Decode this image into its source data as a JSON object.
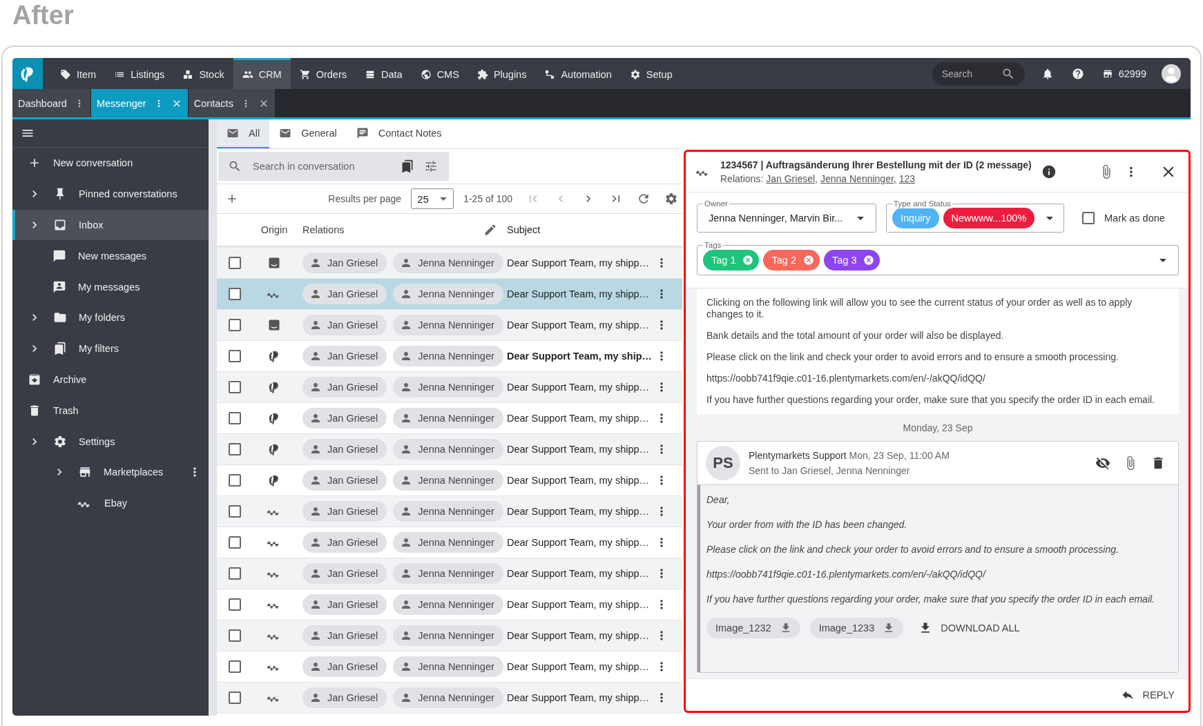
{
  "heading": "After",
  "nav": {
    "items": [
      {
        "label": "Item",
        "selected": false
      },
      {
        "label": "Listings",
        "selected": false
      },
      {
        "label": "Stock",
        "selected": false
      },
      {
        "label": "CRM",
        "selected": true
      },
      {
        "label": "Orders",
        "selected": false
      },
      {
        "label": "Data",
        "selected": false
      },
      {
        "label": "CMS",
        "selected": false
      },
      {
        "label": "Plugins",
        "selected": false
      },
      {
        "label": "Automation",
        "selected": false
      },
      {
        "label": "Setup",
        "selected": false
      }
    ],
    "search": {
      "placeholder": "Search"
    },
    "shop_id": "62999"
  },
  "tabs": [
    {
      "label": "Dashboard",
      "selected": false,
      "closable": false
    },
    {
      "label": "Messenger",
      "selected": true,
      "closable": true
    },
    {
      "label": "Contacts",
      "selected": false,
      "closable": true
    }
  ],
  "sidebar": {
    "items": [
      {
        "label": "New conversation",
        "expandable": false,
        "selected": false,
        "menu": false
      },
      {
        "label": "Pinned converstations",
        "expandable": true,
        "selected": false,
        "menu": false
      },
      {
        "label": "Inbox",
        "expandable": true,
        "selected": true,
        "menu": false,
        "children": [
          {
            "label": "New messages",
            "expandable": false,
            "selected": false,
            "menu": false
          },
          {
            "label": "My messages",
            "expandable": false,
            "selected": false,
            "menu": false
          }
        ]
      },
      {
        "label": "My folders",
        "expandable": true,
        "selected": false,
        "menu": false
      },
      {
        "label": "My filters",
        "expandable": true,
        "selected": false,
        "menu": false
      },
      {
        "label": "Archive",
        "expandable": false,
        "selected": false,
        "menu": false
      },
      {
        "label": "Trash",
        "expandable": false,
        "selected": false,
        "menu": false
      },
      {
        "label": "Settings",
        "expandable": true,
        "selected": false,
        "menu": false,
        "children": [
          {
            "label": "Marketplaces",
            "expandable": true,
            "selected": false,
            "menu": true,
            "children": [
              {
                "label": "Ebay",
                "expandable": false,
                "selected": false,
                "menu": false
              }
            ]
          }
        ]
      }
    ]
  },
  "list": {
    "tabs": [
      {
        "label": "All",
        "selected": true
      },
      {
        "label": "General",
        "selected": false
      },
      {
        "label": "Contact Notes",
        "selected": false
      }
    ],
    "search": {
      "placeholder": "Search in conversation"
    },
    "results_label": "Results per page",
    "per_page": "25",
    "range": "1-25 of 100",
    "columns": [
      "Origin",
      "Relations",
      "Subject"
    ],
    "rows": [
      {
        "kind": "amazon",
        "relations": [
          "Jan Griesel",
          "Jenna Nenninger"
        ],
        "subject": "Dear Support Team, my shipp…",
        "selected": false,
        "unread": false,
        "checked": false
      },
      {
        "kind": "ebay",
        "relations": [
          "Jan Griesel",
          "Jenna Nenninger"
        ],
        "subject": "Dear Support Team, my shipp…",
        "selected": true,
        "unread": false,
        "checked": false
      },
      {
        "kind": "amazon",
        "relations": [
          "Jan Griesel",
          "Jenna Nenninger"
        ],
        "subject": "Dear Support Team, my shipp…",
        "selected": false,
        "unread": false,
        "checked": false
      },
      {
        "kind": "plenty",
        "relations": [
          "Jan Griesel",
          "Jenna Nenninger"
        ],
        "subject": "Dear Support Team, my ship…",
        "selected": false,
        "unread": true,
        "checked": false
      },
      {
        "kind": "plenty",
        "relations": [
          "Jan Griesel",
          "Jenna Nenninger"
        ],
        "subject": "Dear Support Team, my shipp…",
        "selected": false,
        "unread": false,
        "checked": false
      },
      {
        "kind": "plenty",
        "relations": [
          "Jan Griesel",
          "Jenna Nenninger"
        ],
        "subject": "Dear Support Team, my shipp…",
        "selected": false,
        "unread": false,
        "checked": false
      },
      {
        "kind": "plenty",
        "relations": [
          "Jan Griesel",
          "Jenna Nenninger"
        ],
        "subject": "Dear Support Team, my shipp…",
        "selected": false,
        "unread": false,
        "checked": false
      },
      {
        "kind": "plenty",
        "relations": [
          "Jan Griesel",
          "Jenna Nenninger"
        ],
        "subject": "Dear Support Team, my shipp…",
        "selected": false,
        "unread": false,
        "checked": false
      },
      {
        "kind": "ebay",
        "relations": [
          "Jan Griesel",
          "Jenna Nenninger"
        ],
        "subject": "Dear Support Team, my shipp…",
        "selected": false,
        "unread": false,
        "checked": false
      },
      {
        "kind": "ebay",
        "relations": [
          "Jan Griesel",
          "Jenna Nenninger"
        ],
        "subject": "Dear Support Team, my shipp…",
        "selected": false,
        "unread": false,
        "checked": false
      },
      {
        "kind": "ebay",
        "relations": [
          "Jan Griesel",
          "Jenna Nenninger"
        ],
        "subject": "Dear Support Team, my shipp…",
        "selected": false,
        "unread": false,
        "checked": false
      },
      {
        "kind": "ebay",
        "relations": [
          "Jan Griesel",
          "Jenna Nenninger"
        ],
        "subject": "Dear Support Team, my shipp…",
        "selected": false,
        "unread": false,
        "checked": false
      },
      {
        "kind": "ebay",
        "relations": [
          "Jan Griesel",
          "Jenna Nenninger"
        ],
        "subject": "Dear Support Team, my shipp…",
        "selected": false,
        "unread": false,
        "checked": false
      },
      {
        "kind": "ebay",
        "relations": [
          "Jan Griesel",
          "Jenna Nenninger"
        ],
        "subject": "Dear Support Team, my shipp…",
        "selected": false,
        "unread": false,
        "checked": false
      },
      {
        "kind": "ebay",
        "relations": [
          "Jan Griesel",
          "Jenna Nenninger"
        ],
        "subject": "Dear Support Team, my shipp…",
        "selected": false,
        "unread": false,
        "checked": false
      }
    ]
  },
  "conversation": {
    "title": "1234567 | Auftragsänderung Ihrer Bestellung mit der ID (2 message)",
    "relations_label": "Relations:",
    "relations": [
      "Jan Griesel,",
      "Jenna Nenninger,",
      "123"
    ],
    "owner": {
      "legend": "Owner",
      "value": "Jenna Nenninger, Marvin Bir..."
    },
    "type_status": {
      "legend": "Type and Status",
      "chips": [
        {
          "label": "Inquiry",
          "color": "#4fb3f6"
        },
        {
          "label": "Newwww...100%",
          "color": "#ee1c3e"
        }
      ]
    },
    "mark_done": {
      "label": "Mark as done",
      "checked": false
    },
    "tags": {
      "legend": "Tags",
      "items": [
        {
          "label": "Tag 1",
          "color": "#1ec47c"
        },
        {
          "label": "Tag 2",
          "color": "#f7685c"
        },
        {
          "label": "Tag 3",
          "color": "#8d45f0"
        }
      ]
    },
    "first_message": [
      "Clicking on the following link will allow you to see the current status of your order as well as to apply changes to it.",
      "Bank details and the total amount of your order will also be displayed.",
      "Please click on the link and check your order to avoid errors and to ensure a smooth processing.",
      "https://oobb741f9qie.c01-16.plentymarkets.com/en/-/akQQ/idQQ/",
      "If you have further questions regarding your order, make sure that you specify the order ID in each email."
    ],
    "date": "Monday, 23 Sep",
    "message": {
      "initials": "PS",
      "sender": "Plentymarkets Support",
      "time": "Mon, 23 Sep, 11:00 AM",
      "to": "Sent to Jan Griesel, Jenna Nenninger",
      "paragraphs": [
        "Dear,",
        "Your order from with the ID has been changed.",
        "Please click on the link and check your order to avoid errors and to ensure a smooth processing.",
        "https://oobb741f9qie.c01-16.plentymarkets.com/en/-/akQQ/idQQ/",
        "If you have further questions regarding your order, make sure that you specify the order ID in each email."
      ],
      "attachments": [
        "Image_1232",
        "Image_1233"
      ],
      "download_all": "DOWNLOAD ALL"
    },
    "reply": "REPLY"
  }
}
